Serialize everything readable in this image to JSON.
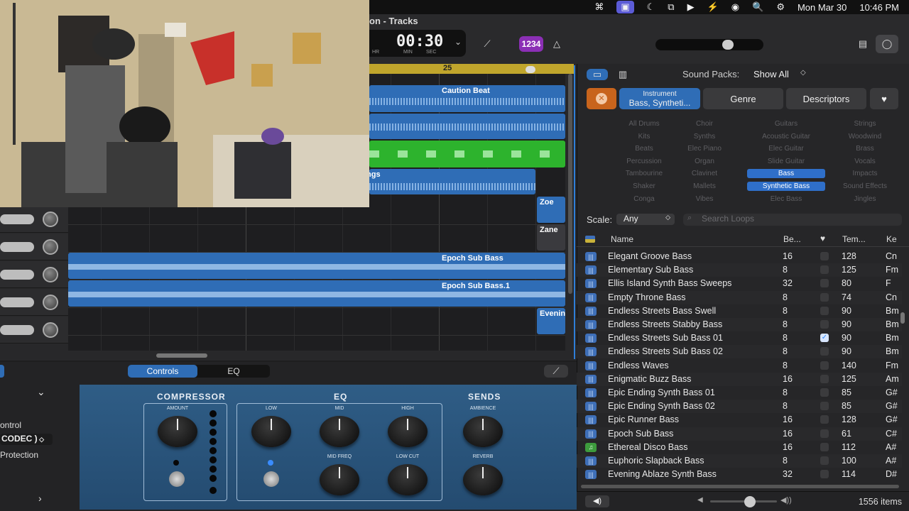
{
  "menubar": {
    "items": [
      "⌘",
      "▣",
      "☾",
      "⧉",
      "▶",
      "⚡",
      "◉",
      "🔍",
      "⚙"
    ],
    "date": "Mon Mar 30",
    "time": "10:46 PM"
  },
  "toolbar": {
    "title": "on - Tracks",
    "lcd_time": "00:30",
    "lcd_hr": "HR",
    "lcd_min": "MIN",
    "lcd_sec": "SEC",
    "count_in": "1234"
  },
  "tracks": {
    "ruler_bar": "25",
    "regions": {
      "caution_beat": "Caution Beat",
      "strings": "ngs",
      "zoe": "Zoe",
      "zane": "Zane",
      "epoch_sub_bass": "Epoch Sub Bass",
      "epoch_sub_bass_1": "Epoch Sub Bass.1",
      "evening": "Evenin"
    }
  },
  "smart_controls": {
    "tab_controls": "Controls",
    "tab_eq": "EQ",
    "side": {
      "label1": "ontrol",
      "select": "CODEC )",
      "label2": "Protection"
    },
    "compressor": "COMPRESSOR",
    "eq": "EQ",
    "sends": "SENDS",
    "knobs": {
      "amount": "AMOUNT",
      "low": "LOW",
      "mid": "MID",
      "high": "HIGH",
      "mid_freq": "MID FREQ",
      "low_cut": "LOW CUT",
      "ambience": "AMBIENCE",
      "reverb": "REVERB"
    }
  },
  "browser": {
    "sound_packs_label": "Sound Packs:",
    "sound_packs_value": "Show All",
    "filter_instrument_title": "Instrument",
    "filter_instrument_value": "Bass, Syntheti...",
    "filter_genre": "Genre",
    "filter_descriptors": "Descriptors",
    "keywords": [
      [
        "All Drums",
        "Choir",
        "Guitars",
        "Strings"
      ],
      [
        "Kits",
        "Synths",
        "Acoustic Guitar",
        "Woodwind"
      ],
      [
        "Beats",
        "Elec Piano",
        "Elec Guitar",
        "Brass"
      ],
      [
        "Percussion",
        "Organ",
        "Slide Guitar",
        "Vocals"
      ],
      [
        "Tambourine",
        "Clavinet",
        "Bass",
        "Impacts"
      ],
      [
        "Shaker",
        "Mallets",
        "Synthetic Bass",
        "Sound Effects"
      ],
      [
        "Conga",
        "Vibes",
        "Elec Bass",
        "Jingles"
      ]
    ],
    "selected_keywords": [
      "Bass",
      "Synthetic Bass"
    ],
    "scale_label": "Scale:",
    "scale_value": "Any",
    "search_placeholder": "Search Loops",
    "columns": {
      "name": "Name",
      "beats": "Be...",
      "tempo": "Tem...",
      "key": "Ke"
    },
    "rows": [
      {
        "name": "Elegant Groove Bass",
        "beats": "16",
        "tempo": "128",
        "key": "Cn",
        "fav": false,
        "green": false
      },
      {
        "name": "Elementary Sub Bass",
        "beats": "8",
        "tempo": "125",
        "key": "Fm",
        "fav": false,
        "green": false
      },
      {
        "name": "Ellis Island Synth Bass Sweeps",
        "beats": "32",
        "tempo": "80",
        "key": "F",
        "fav": false,
        "green": false
      },
      {
        "name": "Empty Throne Bass",
        "beats": "8",
        "tempo": "74",
        "key": "Cn",
        "fav": false,
        "green": false
      },
      {
        "name": "Endless Streets Bass Swell",
        "beats": "8",
        "tempo": "90",
        "key": "Bm",
        "fav": false,
        "green": false
      },
      {
        "name": "Endless Streets Stabby Bass",
        "beats": "8",
        "tempo": "90",
        "key": "Bm",
        "fav": false,
        "green": false
      },
      {
        "name": "Endless Streets Sub Bass 01",
        "beats": "8",
        "tempo": "90",
        "key": "Bm",
        "fav": true,
        "green": false
      },
      {
        "name": "Endless Streets Sub Bass 02",
        "beats": "8",
        "tempo": "90",
        "key": "Bm",
        "fav": false,
        "green": false
      },
      {
        "name": "Endless Waves",
        "beats": "8",
        "tempo": "140",
        "key": "Fm",
        "fav": false,
        "green": false
      },
      {
        "name": "Enigmatic Buzz Bass",
        "beats": "16",
        "tempo": "125",
        "key": "Am",
        "fav": false,
        "green": false
      },
      {
        "name": "Epic Ending Synth Bass 01",
        "beats": "8",
        "tempo": "85",
        "key": "G#",
        "fav": false,
        "green": false
      },
      {
        "name": "Epic Ending Synth Bass 02",
        "beats": "8",
        "tempo": "85",
        "key": "G#",
        "fav": false,
        "green": false
      },
      {
        "name": "Epic Runner Bass",
        "beats": "16",
        "tempo": "128",
        "key": "G#",
        "fav": false,
        "green": false
      },
      {
        "name": "Epoch Sub Bass",
        "beats": "16",
        "tempo": "61",
        "key": "C#",
        "fav": false,
        "green": false
      },
      {
        "name": "Ethereal Disco Bass",
        "beats": "16",
        "tempo": "112",
        "key": "A#",
        "fav": false,
        "green": true
      },
      {
        "name": "Euphoric Slapback Bass",
        "beats": "8",
        "tempo": "100",
        "key": "A#",
        "fav": false,
        "green": false
      },
      {
        "name": "Evening Ablaze Synth Bass",
        "beats": "32",
        "tempo": "114",
        "key": "D#",
        "fav": false,
        "green": false
      }
    ],
    "item_count": "1556 items",
    "preview_volume": 0.6
  }
}
